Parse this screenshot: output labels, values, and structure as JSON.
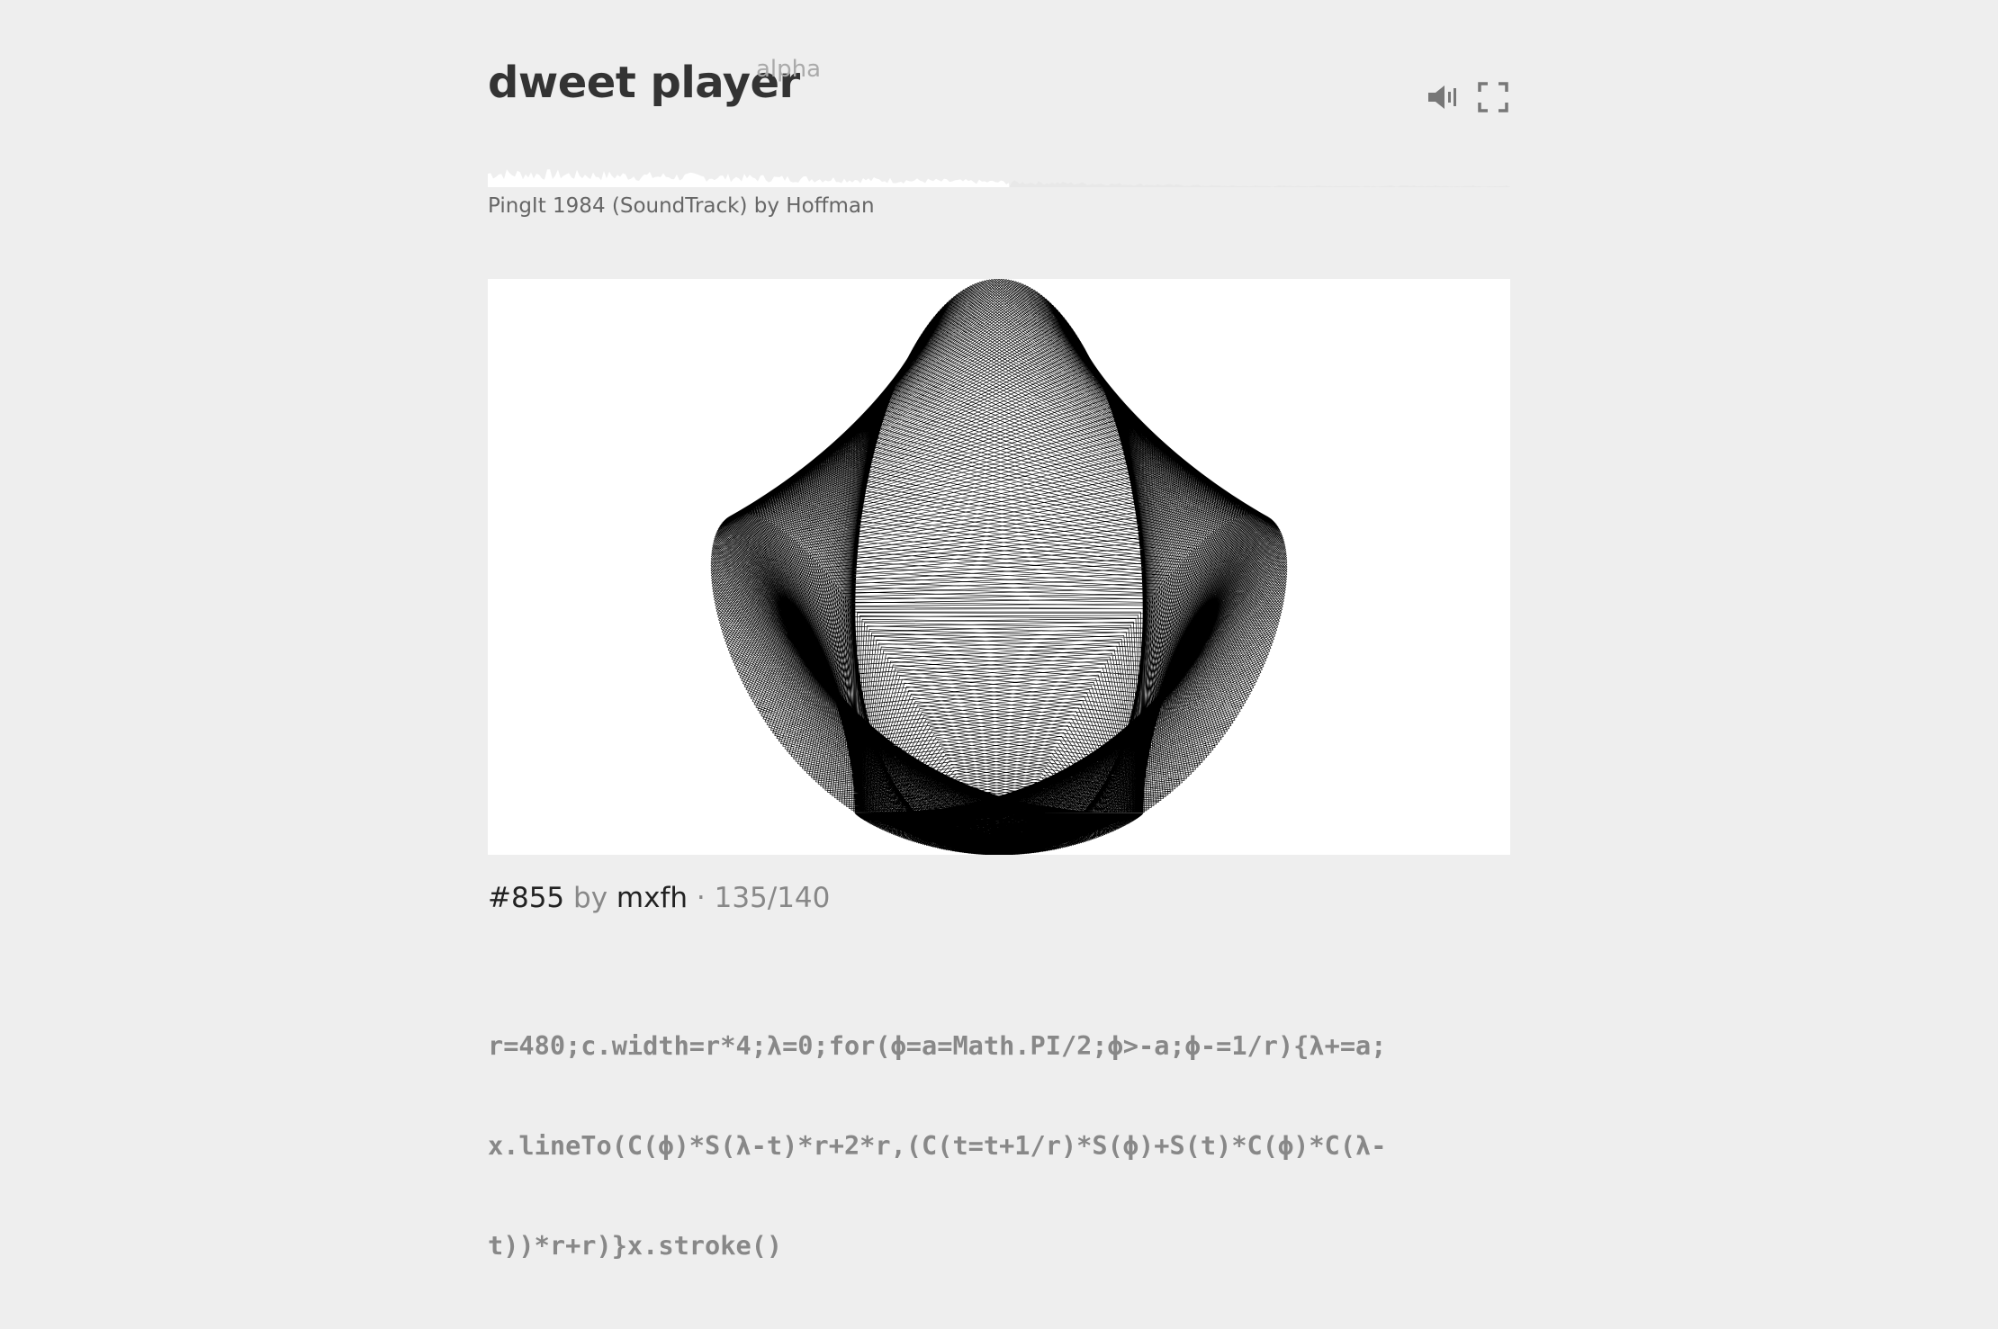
{
  "app": {
    "title": "dweet player",
    "badge": "alpha"
  },
  "controls": {
    "mute_icon": "speaker-mute-icon",
    "fullscreen_icon": "fullscreen-icon"
  },
  "player": {
    "track": "PingIt 1984 (SoundTrack) by Hoffman",
    "progress": 0.51
  },
  "dweet": {
    "id": "#855",
    "by": "by",
    "author": "mxfh",
    "separator": "·",
    "length": "135/140",
    "code_lines": [
      "r=480;c.width=r*4;λ=0;for(ϕ=a=Math.PI/2;ϕ>-a;ϕ-=1/r){λ+=a;",
      "x.lineTo(C(ϕ)*S(λ-t)*r+2*r,(C(t=t+1/r)*S(ϕ)+S(t)*C(ϕ)*C(λ-",
      "t))*r+r)}x.stroke()"
    ]
  },
  "colors": {
    "background": "#eeeeee",
    "canvas": "#ffffff",
    "ink": "#000000"
  }
}
